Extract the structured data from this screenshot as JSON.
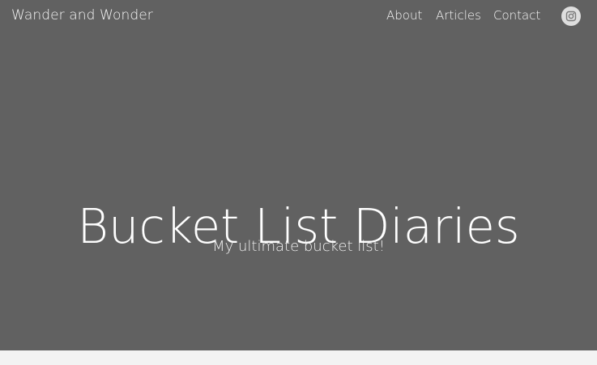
{
  "header": {
    "site_title": "Wander and Wonder",
    "nav": {
      "about": "About",
      "articles": "Articles",
      "contact": "Contact"
    },
    "social_icon": "instagram-icon"
  },
  "hero": {
    "title": "Bucket List Diaries",
    "subtitle": "My ultimate bucket list!",
    "background_color": "#616161"
  },
  "colors": {
    "text": "#ffffff",
    "page_background": "#f3f3f3",
    "icon_background": "#dedede"
  }
}
